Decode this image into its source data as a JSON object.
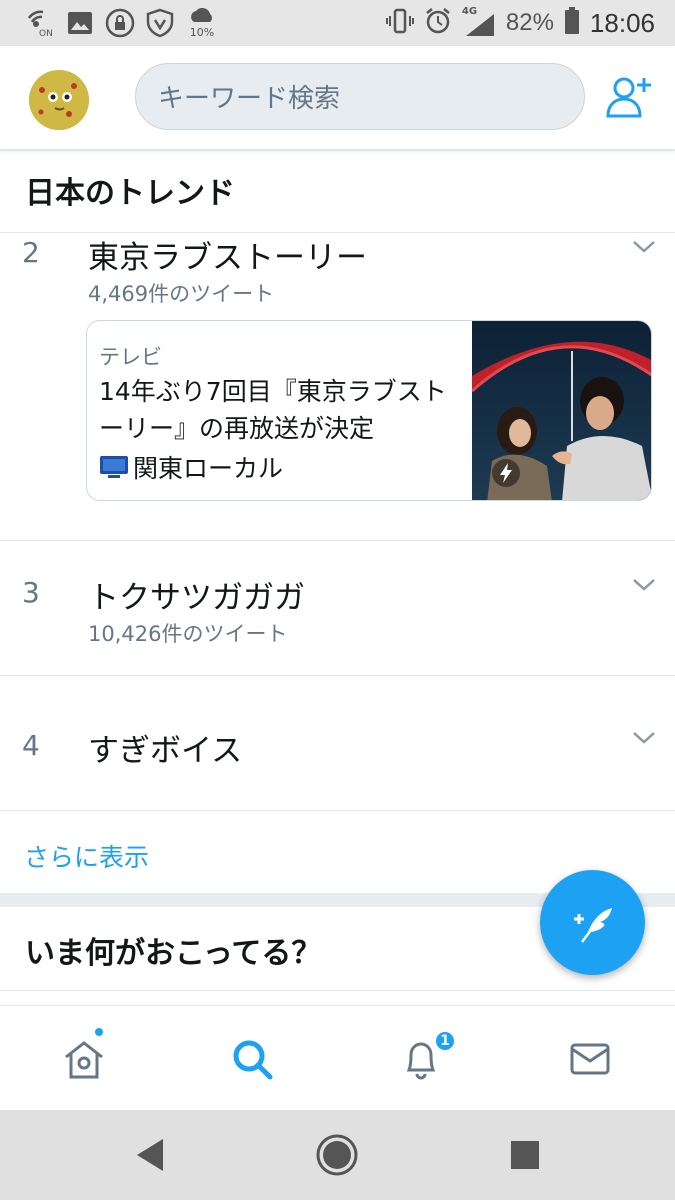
{
  "status_bar": {
    "battery_percent": "82%",
    "time": "18:06",
    "network": "4G",
    "nfc_label": "ON",
    "data_saver_percent": "10%"
  },
  "header": {
    "search_placeholder": "キーワード検索"
  },
  "trends": {
    "title": "日本のトレンド",
    "items": [
      {
        "rank": "2",
        "name": "東京ラブストーリー",
        "count": "4,469件のツイート"
      },
      {
        "rank": "3",
        "name": "トクサツガガガ",
        "count": "10,426件のツイート"
      },
      {
        "rank": "4",
        "name": "すぎボイス",
        "count": ""
      }
    ],
    "card": {
      "category": "テレビ",
      "headline": "14年ぶり7回目『東京ラブストーリー』の再放送が決定",
      "source": "関東ローカル"
    },
    "show_more": "さらに表示"
  },
  "whats_happening": {
    "title": "いま何がおこってる？"
  },
  "tabbar": {
    "notifications_badge": "1"
  },
  "colors": {
    "accent": "#1da1f2",
    "text_primary": "#14171a",
    "text_secondary": "#657786",
    "separator": "#e1e8ed"
  }
}
